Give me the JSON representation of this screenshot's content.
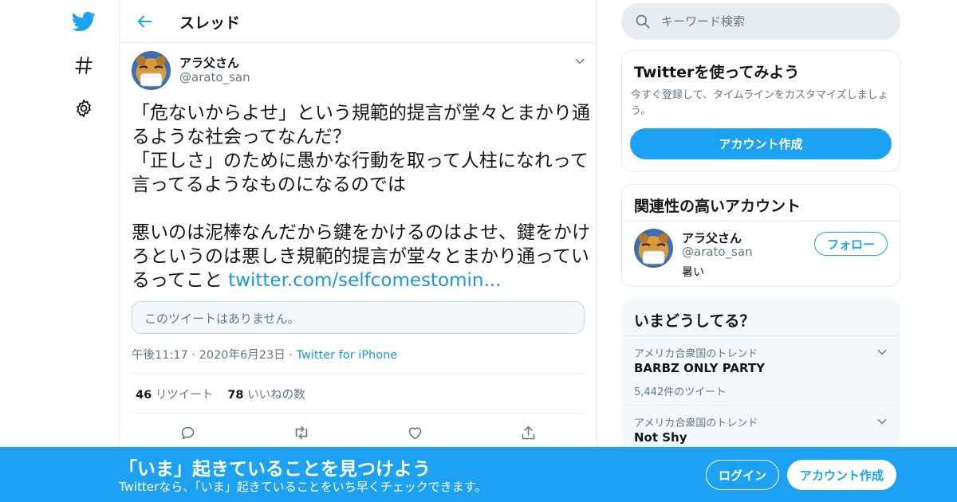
{
  "brand": {
    "accent": "#1da1f2",
    "link": "#1b95e0",
    "muted": "#657786",
    "text": "#14171a"
  },
  "nav": {
    "items": [
      {
        "icon": "twitter-bird-icon"
      },
      {
        "icon": "hashtag-icon"
      },
      {
        "icon": "gear-icon"
      }
    ]
  },
  "header": {
    "title": "スレッド",
    "back_icon": "arrow-left-icon"
  },
  "tweet": {
    "author": {
      "name": "アラ父さん",
      "handle": "@arato_san"
    },
    "text": "「危ないからよせ」という規範的提言が堂々とまかり通るような社会ってなんだ？\n「正しさ」のために愚かな行動を取って人柱になれって言ってるようなものになるのでは\n\n悪いのは泥棒なんだから鍵をかけるのはよせ、鍵をかけろというのは悪しき規範的提言が堂々とまかり通っているってこと ",
    "link_text": "twitter.com/selfcomestomin...",
    "quote_unavailable": "このツイートはありません。",
    "time": "午後11:17",
    "date": "2020年6月23日",
    "separator": "·",
    "source": "Twitter for iPhone",
    "retweets": {
      "count": "46",
      "label": "リツイート"
    },
    "likes": {
      "count": "78",
      "label": "いいねの数"
    }
  },
  "search": {
    "placeholder": "キーワード検索"
  },
  "join": {
    "title": "Twitterを使ってみよう",
    "description": "今すぐ登録して、タイムラインをカスタマイズしましょう。",
    "button": "アカウント作成"
  },
  "related": {
    "title": "関連性の高いアカウント",
    "account": {
      "name": "アラ父さん",
      "handle": "@arato_san",
      "bio": "暑い"
    },
    "follow_button": "フォロー"
  },
  "trends": {
    "title": "いまどうしてる？",
    "items": [
      {
        "context": "アメリカ合衆国のトレンド",
        "name": "BARBZ ONLY PARTY",
        "count": "5,442件のツイート"
      },
      {
        "context": "アメリカ合衆国のトレンド",
        "name": "Not Shy",
        "count": ""
      }
    ]
  },
  "banner": {
    "title": "「いま」起きていることを見つけよう",
    "subtitle": "Twitterなら、「いま」起きていることをいち早くチェックできます。",
    "login": "ログイン",
    "signup": "アカウント作成"
  }
}
